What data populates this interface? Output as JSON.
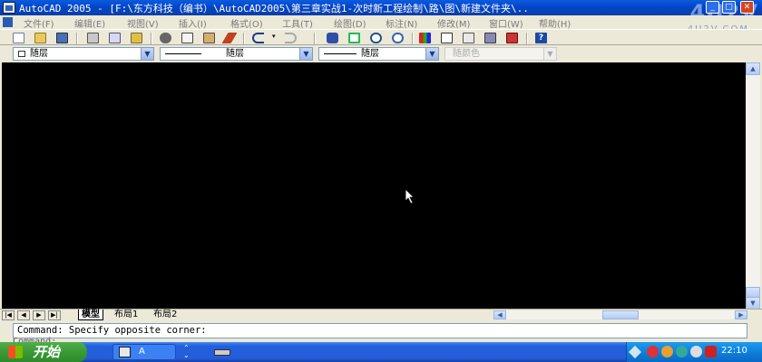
{
  "window": {
    "title": "AutoCAD 2005 - [F:\\东方科技（编书）\\AutoCAD2005\\第三章实战1-次时新工程绘制\\路\\图\\新建文件夹\\..",
    "watermark": "4U2V",
    "watermark_url": "4U2V.COM",
    "min": "_",
    "restore": "□",
    "close": "✕"
  },
  "menu": [
    "文件(F)",
    "编辑(E)",
    "视图(V)",
    "插入(I)",
    "格式(O)",
    "工具(T)",
    "绘图(D)",
    "标注(N)",
    "修改(M)",
    "窗口(W)",
    "帮助(H)"
  ],
  "properties": {
    "layer": "随层",
    "linetype": "随层",
    "lineweight": "随层",
    "color": "随颜色"
  },
  "layout_tabs": [
    "模型",
    "布局1",
    "布局2"
  ],
  "command": {
    "line1": "Command: Specify opposite corner:",
    "line2": "Command:"
  },
  "taskbar": {
    "start": "开始",
    "task1": "A",
    "clock": "22:10"
  },
  "colors": {
    "canvas": "#000000",
    "title_blue": "#0a5be0",
    "start_green": "#3a9a35"
  }
}
